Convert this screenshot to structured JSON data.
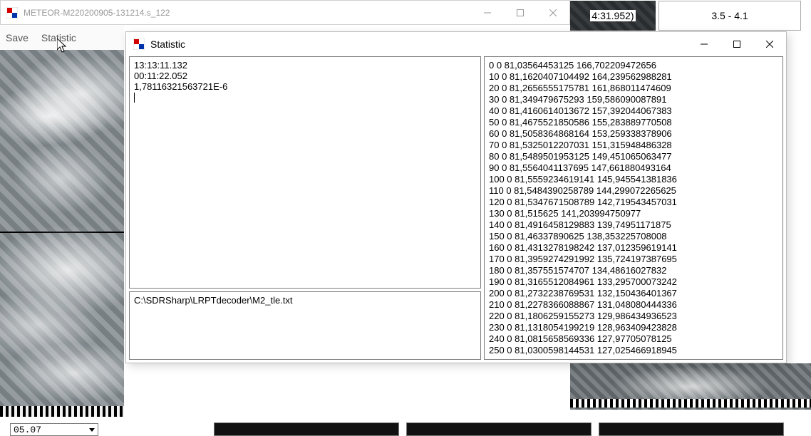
{
  "main_window": {
    "title": "METEOR-M220200905-131214.s_122",
    "menu": {
      "save": "Save",
      "statistic": "Statistic"
    }
  },
  "header_right": {
    "cell1": "4:31.952)",
    "cell2": "3.5 - 4.1"
  },
  "bottom": {
    "combo_value": "05.07"
  },
  "stat_window": {
    "title": "Statistic",
    "left_top_lines": [
      "13:13:11.132",
      "00:11:22.052",
      "1,78116321563721E-6"
    ],
    "left_bottom_path": "C:\\SDRSharp\\LRPTdecoder\\M2_tle.txt",
    "right_lines": [
      "0 0 81,03564453125 166,702209472656",
      "10 0 81,1620407104492 164,239562988281",
      "20 0 81,2656555175781 161,868011474609",
      "30 0 81,349479675293 159,586090087891",
      "40 0 81,4160614013672 157,392044067383",
      "50 0 81,4675521850586 155,283889770508",
      "60 0 81,5058364868164 153,259338378906",
      "70 0 81,5325012207031 151,315948486328",
      "80 0 81,5489501953125 149,451065063477",
      "90 0 81,5564041137695 147,661880493164",
      "100 0 81,5559234619141 145,945541381836",
      "110 0 81,5484390258789 144,299072265625",
      "120 0 81,5347671508789 142,719543457031",
      "130 0 81,515625 141,203994750977",
      "140 0 81,4916458129883 139,74951171875",
      "150 0 81,46337890625 138,353225708008",
      "160 0 81,4313278198242 137,012359619141",
      "170 0 81,3959274291992 135,724197387695",
      "180 0 81,357551574707 134,48616027832",
      "190 0 81,3165512084961 133,295700073242",
      "200 0 81,2732238769531 132,150436401367",
      "210 0 81,2278366088867 131,048080444336",
      "220 0 81,1806259155273 129,986434936523",
      "230 0 81,1318054199219 128,963409423828",
      "240 0 81,0815658569336 127,97705078125",
      "250 0 81,0300598144531 127,025466918945"
    ]
  }
}
